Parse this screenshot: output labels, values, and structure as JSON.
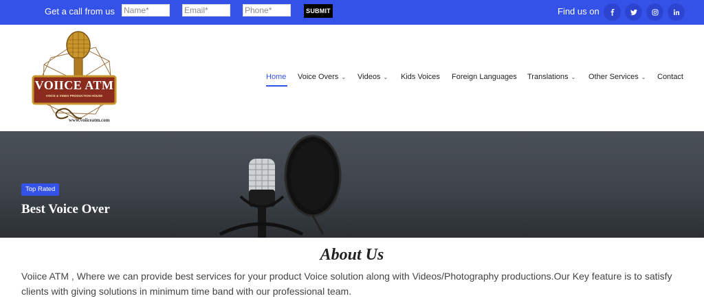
{
  "topbar": {
    "call_label": "Get a call from us",
    "name_placeholder": "Name*",
    "email_placeholder": "Email*",
    "phone_placeholder": "Phone*",
    "submit_label": "SUBMIT",
    "find_label": "Find us on",
    "social": [
      {
        "icon": "facebook-icon",
        "glyph": "f"
      },
      {
        "icon": "twitter-icon",
        "glyph": "t"
      },
      {
        "icon": "instagram-icon",
        "glyph": "ig"
      },
      {
        "icon": "linkedin-icon",
        "glyph": "in"
      }
    ]
  },
  "logo": {
    "title": "VOIICE ATM",
    "subtitle": "VOICE & VIDEO PRODUCTION HOUSE",
    "url": "www.voiiceatm.com"
  },
  "nav": {
    "items": [
      {
        "label": "Home",
        "active": true,
        "dropdown": false
      },
      {
        "label": "Voice Overs",
        "active": false,
        "dropdown": true
      },
      {
        "label": "Videos",
        "active": false,
        "dropdown": true
      },
      {
        "label": "Kids Voices",
        "active": false,
        "dropdown": false
      },
      {
        "label": "Foreign Languages",
        "active": false,
        "dropdown": false
      },
      {
        "label": "Translations",
        "active": false,
        "dropdown": true
      },
      {
        "label": "Other Services",
        "active": false,
        "dropdown": true
      },
      {
        "label": "Contact",
        "active": false,
        "dropdown": false
      }
    ],
    "chevron": "⌄"
  },
  "hero": {
    "badge": "Top Rated",
    "title": "Best Voice Over"
  },
  "about": {
    "title": "About Us",
    "text": "Voiice ATM , Where we can provide best services for your product Voice solution along with Videos/Photography productions.Our Key feature is to satisfy clients with giving solutions in minimum time band with our professional team."
  },
  "colors": {
    "brand": "#3451e8",
    "hero_dark": "#3e444a",
    "logo_red": "#8a2b1e",
    "logo_gold": "#c8962c"
  }
}
